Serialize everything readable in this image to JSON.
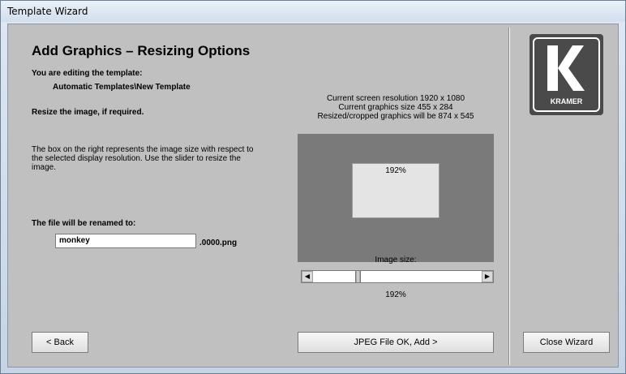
{
  "window": {
    "title": "Template Wizard"
  },
  "main": {
    "heading": "Add Graphics – Resizing Options",
    "editing_label": "You are editing the template:",
    "template_path": "Automatic Templates\\New Template",
    "resize_prompt": "Resize the image, if required.",
    "description_lines": [
      "The box on the right represents the image size with respect to",
      "the selected display resolution. Use the slider to resize the",
      "image."
    ],
    "rename_label": "The file will be renamed to:",
    "filename_value": "monkey",
    "filename_suffix": ".0000.png",
    "resolution_lines": [
      "Current screen resolution 1920 x 1080",
      "Current graphics size 455 x 284",
      "Resized/cropped graphics will be 874 x 545"
    ],
    "preview_percent": "192%",
    "image_size_label": "Image size:",
    "slider_percent": "192%",
    "slider_value_fraction": 0.26
  },
  "buttons": {
    "back": "< Back",
    "add": "JPEG File OK, Add >",
    "close": "Close Wizard"
  },
  "logo": {
    "text": "KRAMER"
  }
}
